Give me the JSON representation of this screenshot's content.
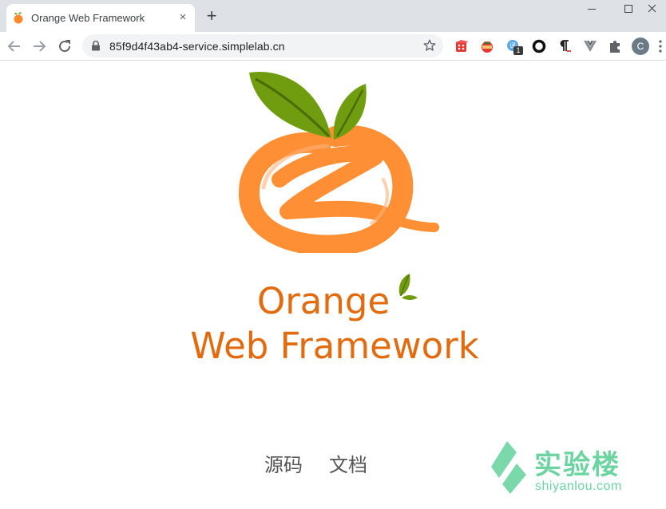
{
  "browser": {
    "tab": {
      "title": "Orange Web Framework",
      "favicon": "orange-favicon-icon",
      "close": "×"
    },
    "new_tab": "+",
    "window_controls": {
      "minimize": "minimize-icon",
      "maximize": "maximize-icon",
      "close": "close-icon"
    },
    "toolbar": {
      "back": "back-arrow-icon",
      "forward": "forward-arrow-icon",
      "reload": "reload-icon",
      "url": "85f9d4f43ab4-service.simplelab.cn",
      "lock": "lock-icon",
      "bookmark": "star-icon",
      "extensions": [
        {
          "name": "dice-extension-icon"
        },
        {
          "name": "tomato-extension-icon"
        },
        {
          "name": "translate-extension-icon",
          "badge": "1"
        },
        {
          "name": "ring-extension-icon"
        },
        {
          "name": "pilcrow-extension-icon"
        },
        {
          "name": "vue-extension-icon"
        },
        {
          "name": "puzzle-extension-icon"
        }
      ],
      "profile_initial": "C",
      "menu": "more-vert-icon"
    }
  },
  "page": {
    "brand_line1": "Orange",
    "brand_line2": "Web Framework",
    "nav": [
      {
        "label": "源码"
      },
      {
        "label": "文档"
      }
    ],
    "watermark": {
      "cn": "实验楼",
      "en": "shiyanlou.com"
    }
  },
  "colors": {
    "brand_orange": "#e26b10",
    "logo_orange": "#ff8a2a",
    "leaf_green": "#6b9a10",
    "watermark_green": "#6cd4a1"
  }
}
